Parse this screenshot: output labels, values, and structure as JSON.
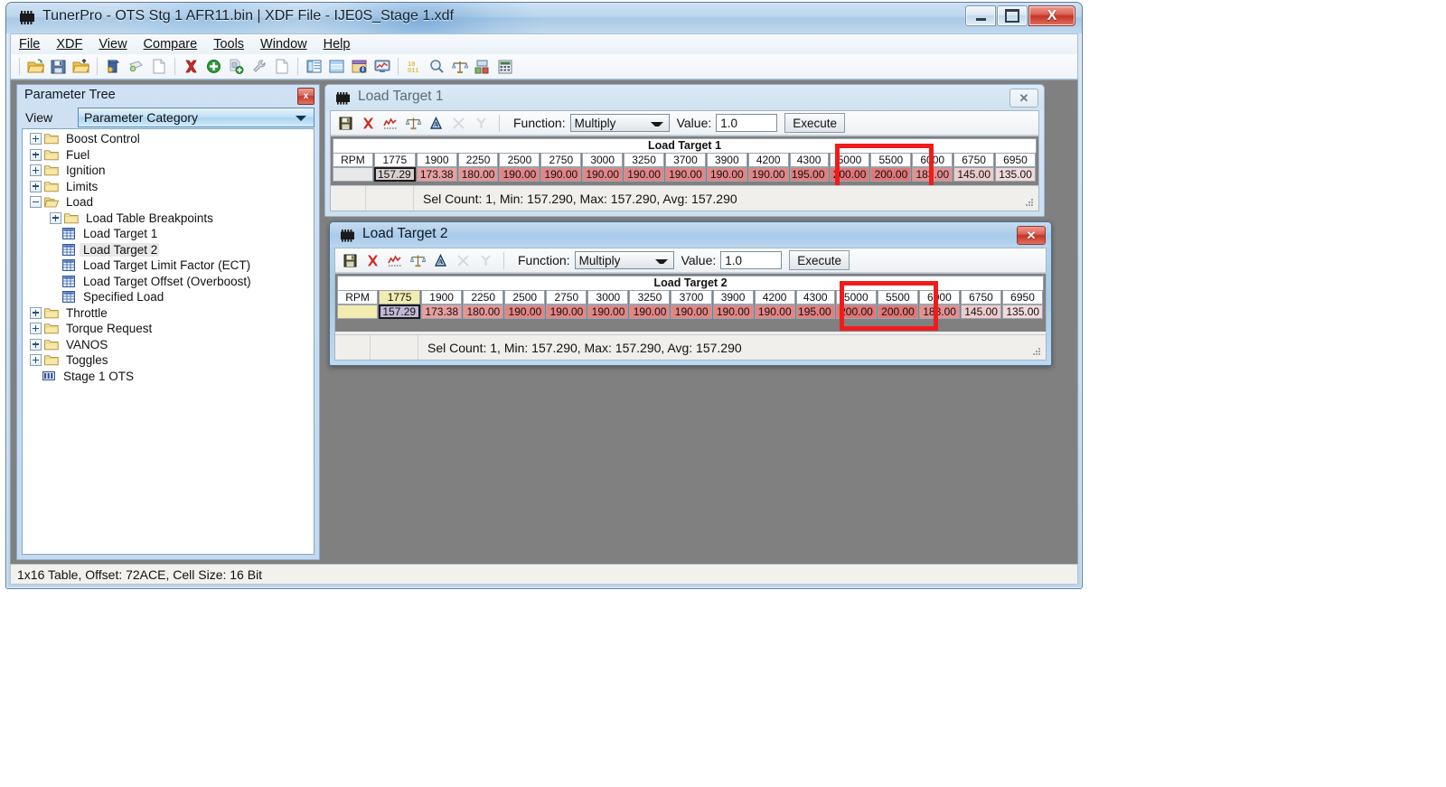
{
  "window": {
    "title": "TunerPro - OTS Stg 1 AFR11.bin | XDF File - IJE0S_Stage 1.xdf",
    "icon": "chip-icon",
    "minimize_label": "Minimize",
    "maximize_label": "Maximize",
    "close_label": "X"
  },
  "menubar": {
    "items": [
      {
        "label": "File",
        "mnemonic": "F"
      },
      {
        "label": "XDF",
        "mnemonic": "X"
      },
      {
        "label": "View",
        "mnemonic": "V"
      },
      {
        "label": "Compare",
        "mnemonic": "C"
      },
      {
        "label": "Tools",
        "mnemonic": "T"
      },
      {
        "label": "Window",
        "mnemonic": "W"
      },
      {
        "label": "Help",
        "mnemonic": "H"
      }
    ]
  },
  "toolbar": {
    "buttons": [
      {
        "name": "open-file-icon",
        "group": 1
      },
      {
        "name": "save-file-icon",
        "group": 1
      },
      {
        "name": "save-as-icon",
        "group": 1
      },
      {
        "name": "open-bin-icon",
        "group": 2
      },
      {
        "name": "close-bin-icon",
        "group": 2
      },
      {
        "name": "new-document-icon",
        "group": 2
      },
      {
        "name": "delete-red-x-icon",
        "group": 3
      },
      {
        "name": "add-green-plus-icon",
        "group": 3
      },
      {
        "name": "copy-add-icon",
        "group": 3
      },
      {
        "name": "wrench-icon",
        "group": 3
      },
      {
        "name": "new-page-icon",
        "group": 3
      },
      {
        "name": "parameter-tree-icon",
        "group": 4
      },
      {
        "name": "table-view-icon",
        "group": 4
      },
      {
        "name": "info-window-icon",
        "group": 4
      },
      {
        "name": "graph-monitor-icon",
        "group": 4
      },
      {
        "name": "hex-editor-icon",
        "group": 5
      },
      {
        "name": "search-icon",
        "group": 5
      },
      {
        "name": "compare-scales-icon",
        "group": 5
      },
      {
        "name": "layout-icon",
        "group": 5
      },
      {
        "name": "calculator-icon",
        "group": 5
      }
    ]
  },
  "parameter_tree": {
    "panel_title": "Parameter Tree",
    "close_label": "x",
    "view_label": "View",
    "category_selected": "Parameter Category",
    "nodes": [
      {
        "label": "Boost Control",
        "type": "folder",
        "depth": 0,
        "expander": "plus",
        "selected": false
      },
      {
        "label": "Fuel",
        "type": "folder",
        "depth": 0,
        "expander": "plus",
        "selected": false
      },
      {
        "label": "Ignition",
        "type": "folder",
        "depth": 0,
        "expander": "plus",
        "selected": false
      },
      {
        "label": "Limits",
        "type": "folder",
        "depth": 0,
        "expander": "plus",
        "selected": false
      },
      {
        "label": "Load",
        "type": "folder-open",
        "depth": 0,
        "expander": "minus",
        "selected": false
      },
      {
        "label": "Load Table Breakpoints",
        "type": "folder",
        "depth": 1,
        "expander": "plus",
        "selected": false
      },
      {
        "label": "Load Target 1",
        "type": "table",
        "depth": 1,
        "expander": "none",
        "selected": false
      },
      {
        "label": "Load Target 2",
        "type": "table",
        "depth": 1,
        "expander": "none",
        "selected": true
      },
      {
        "label": "Load Target Limit Factor (ECT)",
        "type": "table",
        "depth": 1,
        "expander": "none",
        "selected": false
      },
      {
        "label": "Load Target Offset (Overboost)",
        "type": "table",
        "depth": 1,
        "expander": "none",
        "selected": false
      },
      {
        "label": "Specified Load",
        "type": "table",
        "depth": 1,
        "expander": "none",
        "selected": false
      },
      {
        "label": "Throttle",
        "type": "folder",
        "depth": 0,
        "expander": "plus",
        "selected": false
      },
      {
        "label": "Torque Request",
        "type": "folder",
        "depth": 0,
        "expander": "plus",
        "selected": false
      },
      {
        "label": "VANOS",
        "type": "folder",
        "depth": 0,
        "expander": "plus",
        "selected": false
      },
      {
        "label": "Toggles",
        "type": "folder",
        "depth": 0,
        "expander": "plus",
        "selected": false
      },
      {
        "label": "Stage 1 OTS",
        "type": "flag",
        "depth": 0,
        "expander": "none",
        "selected": false
      }
    ]
  },
  "table_windows": [
    {
      "id": "load-target-1",
      "title": "Load Target 1",
      "active": false,
      "caption": "Load Target 1",
      "toolbar": {
        "icons": [
          {
            "name": "save-table-icon",
            "enabled": true
          },
          {
            "name": "revert-red-x-icon",
            "enabled": true
          },
          {
            "name": "graph-plot-icon",
            "enabled": true
          },
          {
            "name": "scales-compare-icon",
            "enabled": true
          },
          {
            "name": "histogram-icon",
            "enabled": true
          },
          {
            "name": "interpolate-h-icon",
            "enabled": false
          },
          {
            "name": "interpolate-v-icon",
            "enabled": false
          }
        ],
        "function_label": "Function:",
        "function_value": "Multiply",
        "value_label": "Value:",
        "value_field": "1.0",
        "execute_label": "Execute"
      },
      "row_header": "RPM",
      "columns": [
        "1775",
        "1900",
        "2250",
        "2500",
        "2750",
        "3000",
        "3250",
        "3700",
        "3900",
        "4200",
        "4300",
        "5000",
        "5500",
        "6000",
        "6750",
        "6950"
      ],
      "values": [
        "157.29",
        "173.38",
        "180.00",
        "190.00",
        "190.00",
        "190.00",
        "190.00",
        "190.00",
        "190.00",
        "190.00",
        "195.00",
        "200.00",
        "200.00",
        "183.00",
        "145.00",
        "135.00"
      ],
      "selected_index": 0,
      "header_highlight_index": -1,
      "status": "Sel Count: 1, Min: 157.290, Max: 157.290, Avg: 157.290"
    },
    {
      "id": "load-target-2",
      "title": "Load Target 2",
      "active": true,
      "caption": "Load Target 2",
      "toolbar": {
        "icons": [
          {
            "name": "save-table-icon",
            "enabled": true
          },
          {
            "name": "revert-red-x-icon",
            "enabled": true
          },
          {
            "name": "graph-plot-icon",
            "enabled": true
          },
          {
            "name": "scales-compare-icon",
            "enabled": true
          },
          {
            "name": "histogram-icon",
            "enabled": true
          },
          {
            "name": "interpolate-h-icon",
            "enabled": false
          },
          {
            "name": "interpolate-v-icon",
            "enabled": false
          }
        ],
        "function_label": "Function:",
        "function_value": "Multiply",
        "value_label": "Value:",
        "value_field": "1.0",
        "execute_label": "Execute"
      },
      "row_header": "RPM",
      "columns": [
        "1775",
        "1900",
        "2250",
        "2500",
        "2750",
        "3000",
        "3250",
        "3700",
        "3900",
        "4200",
        "4300",
        "5000",
        "5500",
        "6000",
        "6750",
        "6950"
      ],
      "values": [
        "157.29",
        "173.38",
        "180.00",
        "190.00",
        "190.00",
        "190.00",
        "190.00",
        "190.00",
        "190.00",
        "190.00",
        "195.00",
        "200.00",
        "200.00",
        "183.00",
        "145.00",
        "135.00"
      ],
      "selected_index": 0,
      "header_highlight_index": 0,
      "status": "Sel Count: 1, Min: 157.290, Max: 157.290, Avg: 157.290"
    }
  ],
  "annotations": {
    "highlight_color": "#f01c1c",
    "highlight_columns": [
      "5000",
      "5500"
    ]
  },
  "statusbar": {
    "text": "1x16 Table, Offset: 72ACE,  Cell Size: 16 Bit"
  }
}
